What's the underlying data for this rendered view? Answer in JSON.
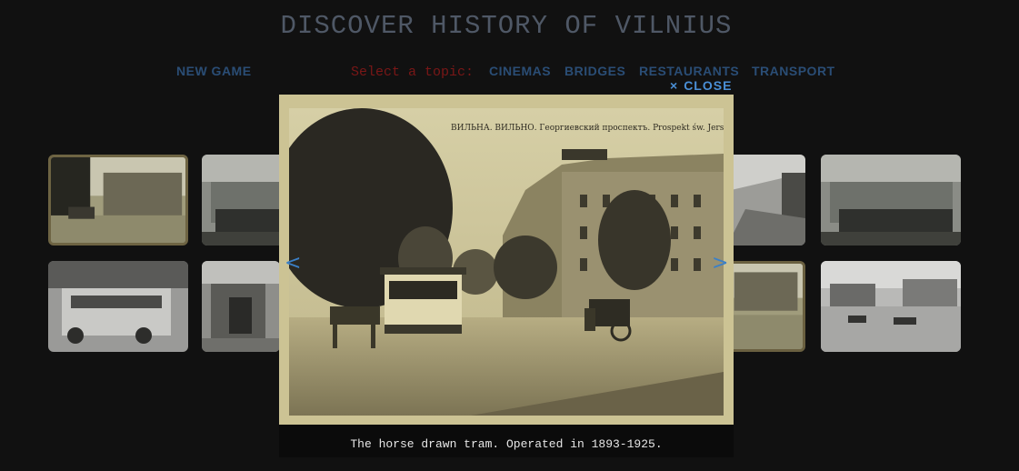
{
  "title": "DISCOVER HISTORY OF VILNIUS",
  "nav": {
    "new_game": "NEW GAME",
    "topic_prompt": "Select a topic:",
    "topics": [
      "CINEMAS",
      "BRIDGES",
      "RESTAURANTS",
      "TRANSPORT"
    ]
  },
  "lightbox": {
    "close_icon": "×",
    "close_label": "CLOSE",
    "caption": "The horse drawn tram. Operated in 1893-1925.",
    "prev_icon": "<",
    "next_icon": ">",
    "photo_header_text": "ВИЛЬНА. ВИЛЬНО. Георгиевский проспектъ. Prospekt św. Jerski"
  },
  "colors": {
    "background": "#111111",
    "title": "#4f5866",
    "nav_link": "#2a4d75",
    "topic_label": "#7a1717",
    "close": "#4a8fd6",
    "sepia": "#ccc394"
  },
  "thumbnails": [
    {
      "subject": "horse-tram-street",
      "selected": true
    },
    {
      "subject": "trolleybus-station",
      "selected": false
    },
    {
      "subject": "railway-platform",
      "selected": false
    },
    {
      "subject": "trolleybus-station",
      "selected": false
    },
    {
      "subject": "vintage-bus",
      "selected": false
    },
    {
      "subject": "station-entrance",
      "selected": false
    },
    {
      "subject": "horse-tram-street",
      "selected": false
    },
    {
      "subject": "winter-square-sleighs",
      "selected": false
    }
  ]
}
